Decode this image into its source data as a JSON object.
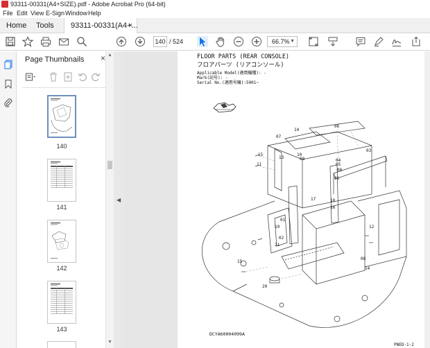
{
  "window": {
    "title": "93311-00331(A4+SIZE).pdf - Adobe Acrobat Pro (64-bit)"
  },
  "menu": [
    "File",
    "Edit",
    "View",
    "E-Sign",
    "Window",
    "Help"
  ],
  "tabs": {
    "home": "Home",
    "tools": "Tools",
    "document": "93311-00331(A4+...",
    "close_glyph": "×"
  },
  "toolbar": {
    "current_page": "140",
    "page_separator": "/",
    "total_pages": "524",
    "zoom": "66.7%"
  },
  "panel": {
    "title": "Page Thumbnails",
    "close_glyph": "×",
    "thumbnails": [
      {
        "label": "140",
        "selected": true
      },
      {
        "label": "141",
        "selected": false
      },
      {
        "label": "142",
        "selected": false
      },
      {
        "label": "143",
        "selected": false
      }
    ]
  },
  "page": {
    "title_en": "FLOOR PARTS (REAR CONSOLE)",
    "title_jp": "フロアパーツ (リアコンソール)",
    "applicable_model": "Applicable Model(適用機種): -",
    "mark": "Mark(記号): -",
    "serial": "Serial No.(適用号機):5001~",
    "figure_code": "DCYA60004099A",
    "page_code": "PNED-1-2",
    "callouts": [
      "14",
      "06",
      "07",
      "15",
      "13",
      "11",
      "10",
      "09",
      "04",
      "05",
      "08",
      "03",
      "17",
      "16",
      "18",
      "01",
      "02",
      "19",
      "21",
      "15",
      "08",
      "15",
      "20",
      "14",
      "15",
      "12",
      "05",
      "05"
    ]
  },
  "colors": {
    "accent": "#1473e6",
    "pdf_red": "#d32f2f",
    "panel_bg": "#ffffff",
    "doc_bg": "#e6e6e6"
  }
}
